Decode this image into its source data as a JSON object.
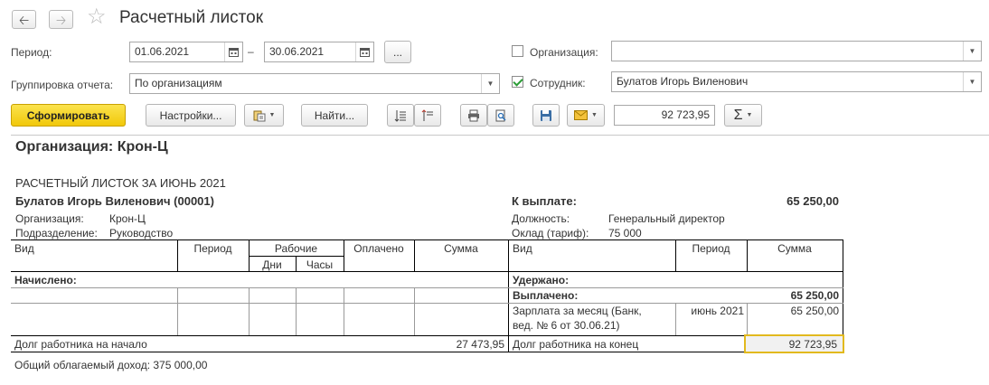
{
  "window": {
    "title": "Расчетный листок"
  },
  "filters": {
    "period_label": "Период:",
    "date_from": "01.06.2021",
    "date_to": "30.06.2021",
    "period_dash": "–",
    "period_more": "...",
    "org_label": "Организация:",
    "org_checked": false,
    "org_value": "",
    "grouping_label": "Группировка отчета:",
    "grouping_value": "По организациям",
    "employee_label": "Сотрудник:",
    "employee_checked": true,
    "employee_value": "Булатов Игорь Виленович"
  },
  "toolbar": {
    "generate": "Сформировать",
    "settings": "Настройки...",
    "find": "Найти...",
    "sum_value": "92 723,95",
    "sigma": "Σ"
  },
  "report": {
    "org_title": "Организация: Крон-Ц",
    "title": "РАСЧЕТНЫЙ ЛИСТОК ЗА ИЮНЬ 2021",
    "employee": "Булатов Игорь Виленович (00001)",
    "to_pay_label": "К выплате:",
    "to_pay_value": "65 250,00",
    "org_label": "Организация:",
    "org_value": "Крон-Ц",
    "dept_label": "Подразделение:",
    "dept_value": "Руководство",
    "position_label": "Должность:",
    "position_value": "Генеральный директор",
    "salary_label": "Оклад (тариф):",
    "salary_value": "75 000",
    "headers_left": {
      "kind": "Вид",
      "period": "Период",
      "worked": "Рабочие",
      "days": "Дни",
      "hours": "Часы",
      "paid": "Оплачено",
      "sum": "Сумма"
    },
    "headers_right": {
      "kind": "Вид",
      "period": "Период",
      "sum": "Сумма"
    },
    "accrued_label": "Начислено:",
    "withheld_label": "Удержано:",
    "paid_label": "Выплачено:",
    "paid_total": "65 250,00",
    "paid_row": {
      "kind_line1": "Зарплата за месяц (Банк,",
      "kind_line2": "вед. № 6 от 30.06.21)",
      "period": "июнь 2021",
      "sum": "65 250,00"
    },
    "debt_start_label": "Долг работника на начало",
    "debt_start_value": "27 473,95",
    "debt_end_label": "Долг работника на конец",
    "debt_end_value": "92 723,95",
    "taxable_income": "Общий облагаемый доход: 375 000,00"
  }
}
